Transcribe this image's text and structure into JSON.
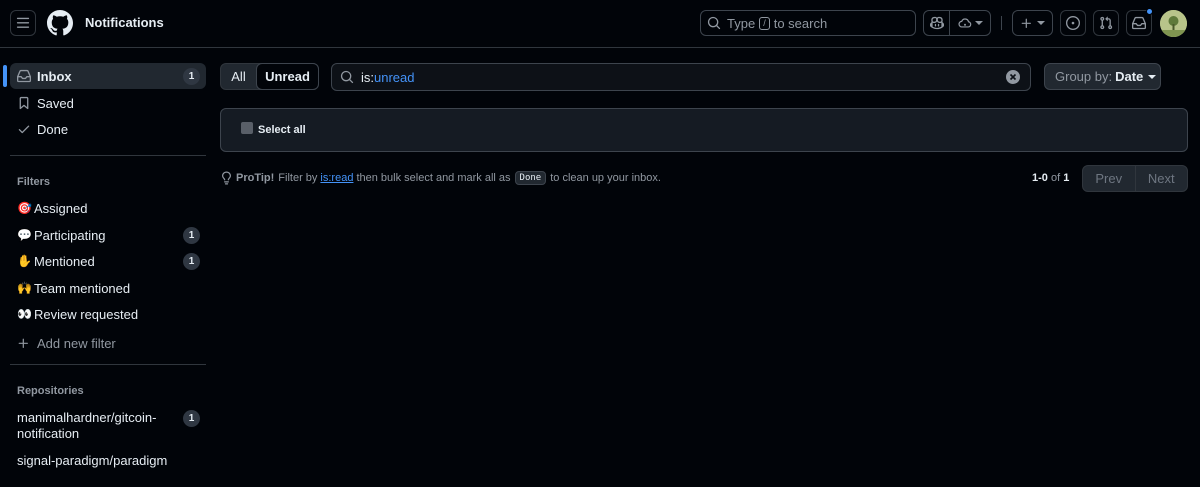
{
  "header": {
    "context_title": "Notifications",
    "search": {
      "prefix": "Type",
      "key": "/",
      "suffix": "to search"
    },
    "icons": [
      "menu-icon",
      "github-logo",
      "search-icon",
      "copilot-icon",
      "copilot-dropdown-icon",
      "plus-icon",
      "issue-icon",
      "pull-request-icon",
      "inbox-icon"
    ]
  },
  "sidebar": {
    "nav": [
      {
        "label": "Inbox",
        "count": "1",
        "icon": "inbox-icon"
      },
      {
        "label": "Saved",
        "icon": "bookmark-icon"
      },
      {
        "label": "Done",
        "icon": "check-icon"
      }
    ],
    "filters_heading": "Filters",
    "filters": [
      {
        "emoji": "🎯",
        "label": "Assigned"
      },
      {
        "emoji": "💬",
        "label": "Participating",
        "count": "1"
      },
      {
        "emoji": "✋",
        "label": "Mentioned",
        "count": "1"
      },
      {
        "emoji": "🙌",
        "label": "Team mentioned"
      },
      {
        "emoji": "👀",
        "label": "Review requested"
      }
    ],
    "add_filter": "Add new filter",
    "repositories_heading": "Repositories",
    "repositories": [
      {
        "line1": "manimalhardner/gitcoin-",
        "line2": "notification",
        "count": "1"
      },
      {
        "line1": "signal-paradigm/paradigm"
      }
    ]
  },
  "main": {
    "segments": {
      "all": "All",
      "unread": "Unread",
      "selected": "Unread"
    },
    "query": {
      "key": "is:",
      "value": "unread"
    },
    "group_by": {
      "label": "Group by:",
      "value": "Date"
    },
    "select_all": "Select all",
    "protip": {
      "lead": "ProTip!",
      "t1": "Filter by",
      "link": "is:read",
      "t2": "then bulk select and mark all as",
      "code": "Done",
      "t3": "to clean up your inbox."
    },
    "pagination": {
      "range": "1-0",
      "of": "of",
      "total": "1",
      "prev": "Prev",
      "next": "Next"
    }
  },
  "colors": {
    "accent": "#4493f8",
    "background": "#010409",
    "border": "#30363d"
  }
}
